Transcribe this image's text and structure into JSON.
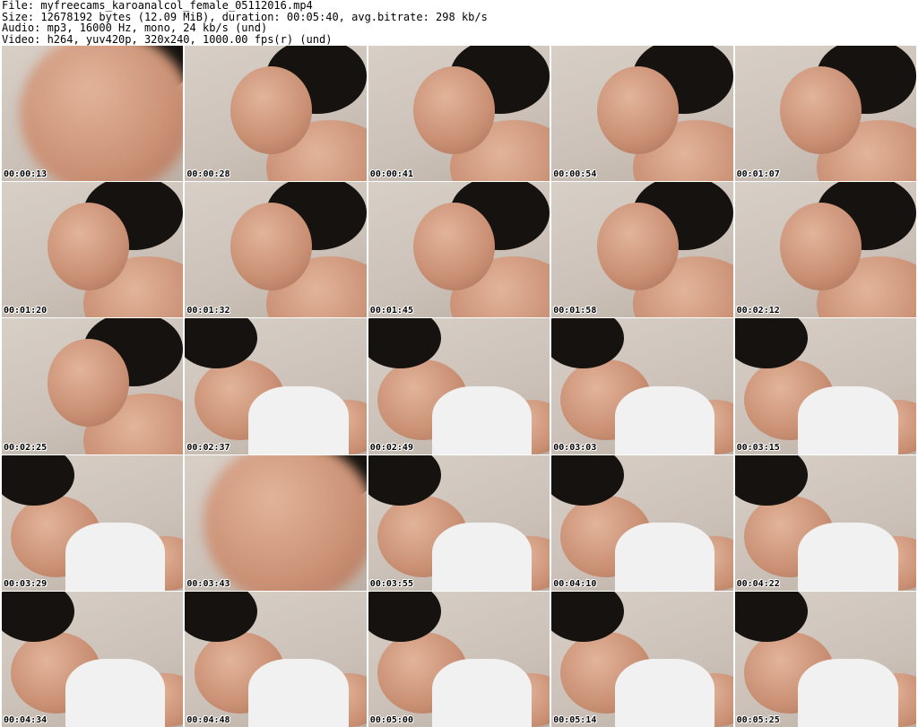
{
  "header": {
    "file_line": "File: myfreecams_karoanalcol_female_05112016.mp4",
    "size_line": "Size: 12678192 bytes (12.09 MiB), duration: 00:05:40, avg.bitrate: 298 kb/s",
    "audio_line": "Audio: mp3, 16000 Hz, mono, 24 kb/s (und)",
    "video_line": "Video: h264, yuv420p, 320x240, 1000.00 fps(r) (und)"
  },
  "thumbnails": [
    {
      "timestamp": "00:00:13",
      "scene": "closeup"
    },
    {
      "timestamp": "00:00:28",
      "scene": "profile"
    },
    {
      "timestamp": "00:00:41",
      "scene": "profile"
    },
    {
      "timestamp": "00:00:54",
      "scene": "profile"
    },
    {
      "timestamp": "00:01:07",
      "scene": "profile"
    },
    {
      "timestamp": "00:01:20",
      "scene": "profile"
    },
    {
      "timestamp": "00:01:32",
      "scene": "profile"
    },
    {
      "timestamp": "00:01:45",
      "scene": "profile"
    },
    {
      "timestamp": "00:01:58",
      "scene": "profile"
    },
    {
      "timestamp": "00:02:12",
      "scene": "profile"
    },
    {
      "timestamp": "00:02:25",
      "scene": "face"
    },
    {
      "timestamp": "00:02:37",
      "scene": "body"
    },
    {
      "timestamp": "00:02:49",
      "scene": "body"
    },
    {
      "timestamp": "00:03:03",
      "scene": "body"
    },
    {
      "timestamp": "00:03:15",
      "scene": "body"
    },
    {
      "timestamp": "00:03:29",
      "scene": "body"
    },
    {
      "timestamp": "00:03:43",
      "scene": "closeup"
    },
    {
      "timestamp": "00:03:55",
      "scene": "body"
    },
    {
      "timestamp": "00:04:10",
      "scene": "body"
    },
    {
      "timestamp": "00:04:22",
      "scene": "body"
    },
    {
      "timestamp": "00:04:34",
      "scene": "body"
    },
    {
      "timestamp": "00:04:48",
      "scene": "body"
    },
    {
      "timestamp": "00:05:00",
      "scene": "body"
    },
    {
      "timestamp": "00:05:14",
      "scene": "body"
    },
    {
      "timestamp": "00:05:25",
      "scene": "body"
    }
  ]
}
